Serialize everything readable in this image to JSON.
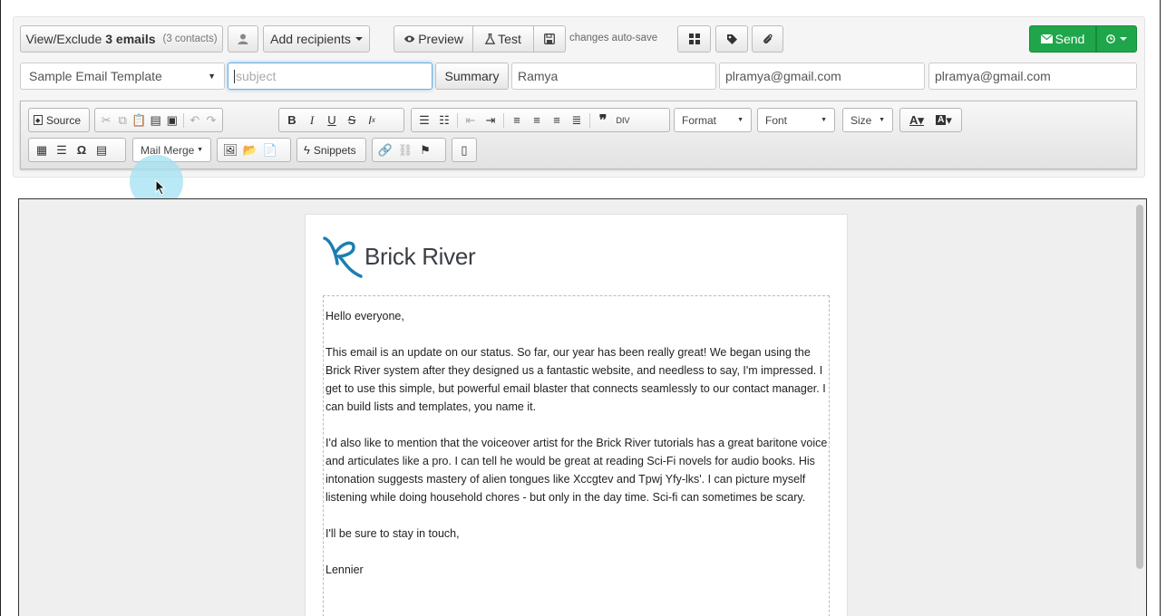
{
  "header": {
    "view_exclude": {
      "prefix": "View/Exclude",
      "count": "3 emails",
      "contacts": "(3 contacts)"
    },
    "add_recipients": "Add recipients",
    "preview": "Preview",
    "test": "Test",
    "autosave": "changes auto-save",
    "send": "Send"
  },
  "form": {
    "template_select": "Sample Email Template",
    "subject_placeholder": "subject",
    "summary": "Summary",
    "from_name": "Ramya",
    "from_email": "plramya@gmail.com",
    "reply_email": "plramya@gmail.com"
  },
  "toolbar": {
    "source": "Source",
    "format": "Format",
    "font": "Font",
    "size": "Size",
    "mail_merge": "Mail Merge",
    "snippets": "Snippets"
  },
  "email": {
    "brand": "Brick River",
    "greeting": "Hello everyone,",
    "paragraph1": "This email is an update on our status. So far, our year has been really great! We began using the Brick River system after they designed us a fantastic website, and needless to say, I'm impressed. I get to use this simple, but powerful email blaster that connects seamlessly to our contact manager. I can build lists and templates, you name it.",
    "paragraph2": "I'd also like to mention that the voiceover artist for the Brick River tutorials has a great baritone voice and articulates like a pro. I can tell he would be great at reading Sci-Fi novels for audio books. His intonation suggests mastery of alien tongues like Xccgtev and Tpwj Yfy-lks'. I can picture myself listening while doing household chores - but only in the day time. Sci-fi can sometimes be scary.",
    "closing": "I'll be sure to stay in touch,",
    "signature": "Lennier"
  },
  "colors": {
    "send_green": "#1fa64a",
    "focus_blue": "#66afe9",
    "logo_blue": "#1a7fb3"
  }
}
